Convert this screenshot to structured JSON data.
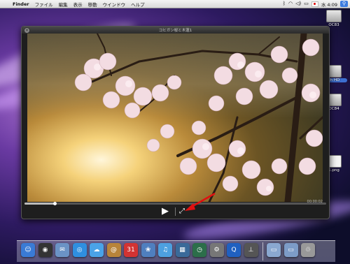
{
  "menubar": {
    "app": "Finder",
    "menus": [
      "ファイル",
      "編集",
      "表示",
      "移動",
      "ウインドウ",
      "ヘルプ"
    ],
    "clock": "水 4:09"
  },
  "desktop_icons": [
    {
      "name": "disk-icon",
      "label": "OC83"
    },
    {
      "name": "hd-icon",
      "label": "sh HD"
    },
    {
      "name": "disk2-icon",
      "label": "OC84"
    },
    {
      "name": "image-file-icon",
      "label": "1.png"
    }
  ],
  "video_window": {
    "title": "コヒガン桜と木蓮1",
    "timecode": "00:00:02",
    "progress": 0.1
  },
  "colors": {
    "annotation": "#e01010",
    "dock_glass": "#a0a0c0"
  },
  "dock": {
    "items": [
      {
        "name": "finder-icon",
        "glyph": "☺",
        "color": "#3a7bd5"
      },
      {
        "name": "dashboard-icon",
        "glyph": "◉",
        "color": "#333333"
      },
      {
        "name": "mail-icon",
        "glyph": "✉",
        "color": "#6b93c5"
      },
      {
        "name": "safari-icon",
        "glyph": "◎",
        "color": "#2f8fe0"
      },
      {
        "name": "ichat-icon",
        "glyph": "☁",
        "color": "#4aa3e8"
      },
      {
        "name": "address-book-icon",
        "glyph": "@",
        "color": "#b8843a"
      },
      {
        "name": "ical-icon",
        "glyph": "31",
        "color": "#d33333"
      },
      {
        "name": "iphoto-icon",
        "glyph": "❀",
        "color": "#4f7fbf"
      },
      {
        "name": "itunes-icon",
        "glyph": "♫",
        "color": "#4da0e0"
      },
      {
        "name": "spaces-icon",
        "glyph": "▦",
        "color": "#3a6a99"
      },
      {
        "name": "time-machine-icon",
        "glyph": "◷",
        "color": "#2c6e4a"
      },
      {
        "name": "system-preferences-icon",
        "glyph": "⚙",
        "color": "#777777"
      },
      {
        "name": "quicktime-icon",
        "glyph": "Q",
        "color": "#2060c0"
      },
      {
        "name": "utility-icon",
        "glyph": "⊥",
        "color": "#555555"
      },
      {
        "name": "applications-folder-icon",
        "glyph": "▭",
        "color": "#8aa8d0"
      },
      {
        "name": "downloads-folder-icon",
        "glyph": "▭",
        "color": "#7d9cc7"
      },
      {
        "name": "trash-icon",
        "glyph": "♲",
        "color": "#999999"
      }
    ]
  }
}
